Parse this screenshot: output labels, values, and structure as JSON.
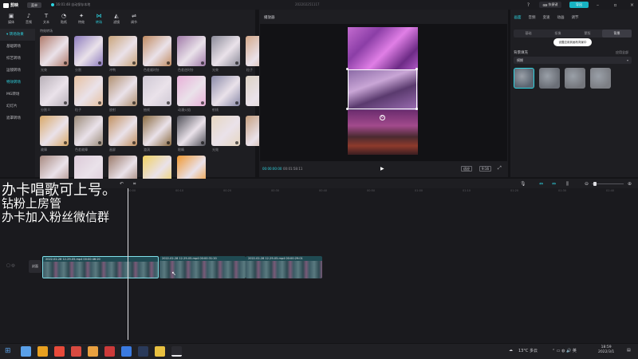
{
  "app": {
    "name": "剪映",
    "menu_label": "菜单",
    "status_text": "16:01:48 自动保存本地",
    "project_title": "202202251117",
    "shortcut_label": "快捷键",
    "export_label": "导出"
  },
  "media_tabs": [
    {
      "label": "媒体",
      "icon": "media-icon"
    },
    {
      "label": "音频",
      "icon": "audio-icon"
    },
    {
      "label": "文本",
      "icon": "text-icon"
    },
    {
      "label": "贴纸",
      "icon": "sticker-icon"
    },
    {
      "label": "特效",
      "icon": "effects-icon"
    },
    {
      "label": "转场",
      "icon": "transition-icon"
    },
    {
      "label": "滤镜",
      "icon": "filter-icon"
    },
    {
      "label": "调节",
      "icon": "adjust-icon"
    }
  ],
  "categories": {
    "head": "▾ 转场效果",
    "items": [
      "基础转场",
      "综艺转场",
      "运镜转场",
      "特效转场",
      "MG转场",
      "幻灯片",
      "遮罩转场"
    ],
    "active_index": 3
  },
  "grid": {
    "title": "特效转场",
    "items": [
      {
        "label": "光束",
        "color": "#b07a6a"
      },
      {
        "label": "分割",
        "color": "#8d7bbd"
      },
      {
        "label": "冲鸭",
        "color": "#c9a47a"
      },
      {
        "label": "色差顺时针",
        "color": "#c08a60"
      },
      {
        "label": "色差逆时针",
        "color": "#a07aa8"
      },
      {
        "label": "光束",
        "color": "#8a8a98"
      },
      {
        "label": "粒子",
        "color": "#d4a98a"
      },
      {
        "label": "分割 II",
        "color": "#b8b0b8"
      },
      {
        "label": "粒子",
        "color": "#e6c0a0"
      },
      {
        "label": "放射",
        "color": "#b09070"
      },
      {
        "label": "抽帧",
        "color": "#cfc8d4"
      },
      {
        "label": "动漫火焰",
        "color": "#e8b0d8"
      },
      {
        "label": "射线",
        "color": "#8a8aa8"
      },
      {
        "label": "",
        "color": "#dcd2c4"
      },
      {
        "label": "故障",
        "color": "#d8a868"
      },
      {
        "label": "色差故障",
        "color": "#9a8a78"
      },
      {
        "label": "画屏",
        "color": "#c09060"
      },
      {
        "label": "漩涡",
        "color": "#8a6a40"
      },
      {
        "label": "眼睛",
        "color": "#505058"
      },
      {
        "label": "光效",
        "color": "#e6d6c0"
      },
      {
        "label": "",
        "color": "#c6a080"
      },
      {
        "label": "",
        "color": "#a88a80"
      },
      {
        "label": "",
        "color": "#dccad8"
      },
      {
        "label": "",
        "color": "#9a7a6a"
      },
      {
        "label": "",
        "color": "#f0d060"
      },
      {
        "label": "",
        "color": "#f09830"
      }
    ]
  },
  "player": {
    "title": "播放器",
    "current_time": "00:00:00:00",
    "total_time": "00:01:58:11",
    "btn_fit": "适应",
    "btn_ratio": "9:16"
  },
  "inspector": {
    "tabs": [
      "画面",
      "音频",
      "变速",
      "动画",
      "调节"
    ],
    "active_tab": 0,
    "subtabs": [
      "基础",
      "抠像",
      "蒙版",
      "背景"
    ],
    "active_subtab": 3,
    "tooltip": "设置应用到画布背景中",
    "bg_fill_label": "背景填充",
    "reset_label": "应用全部",
    "select_value": "模糊",
    "swatches": [
      "#5a6470",
      "#6a6e76",
      "#74767c",
      "#7c7e84"
    ]
  },
  "timeline": {
    "ruler_ticks": [
      "00:00",
      "00:10",
      "00:20",
      "00:30",
      "00:40",
      "00:50",
      "01:00",
      "01:10",
      "01:20",
      "01:30",
      "01:40"
    ],
    "track_label": "封面",
    "clips": [
      {
        "name": "2022-02-28 12-29-05.mp4   00:00:46:20"
      },
      {
        "name": "2022-02-28 12-29-05.mp4   00:00:31:20"
      },
      {
        "name": "2022-02-28 12-29-05.mp4   00:00:29:01"
      }
    ]
  },
  "overlay": {
    "line1": "办卡唱歌可上号。",
    "line2": "钻粉上房管",
    "line3": "办卡加入粉丝微信群"
  },
  "taskbar": {
    "apps": [
      "#5aa0e8",
      "#e8a020",
      "#e84a3a",
      "#d84a40",
      "#e8a040",
      "#cc3a3a",
      "#3a7ae0",
      "#2a3a5a",
      "#e8c040",
      "#e8e8ec"
    ],
    "weather": "13°C 多云",
    "time": "18:59",
    "date": "2022/3/1"
  }
}
